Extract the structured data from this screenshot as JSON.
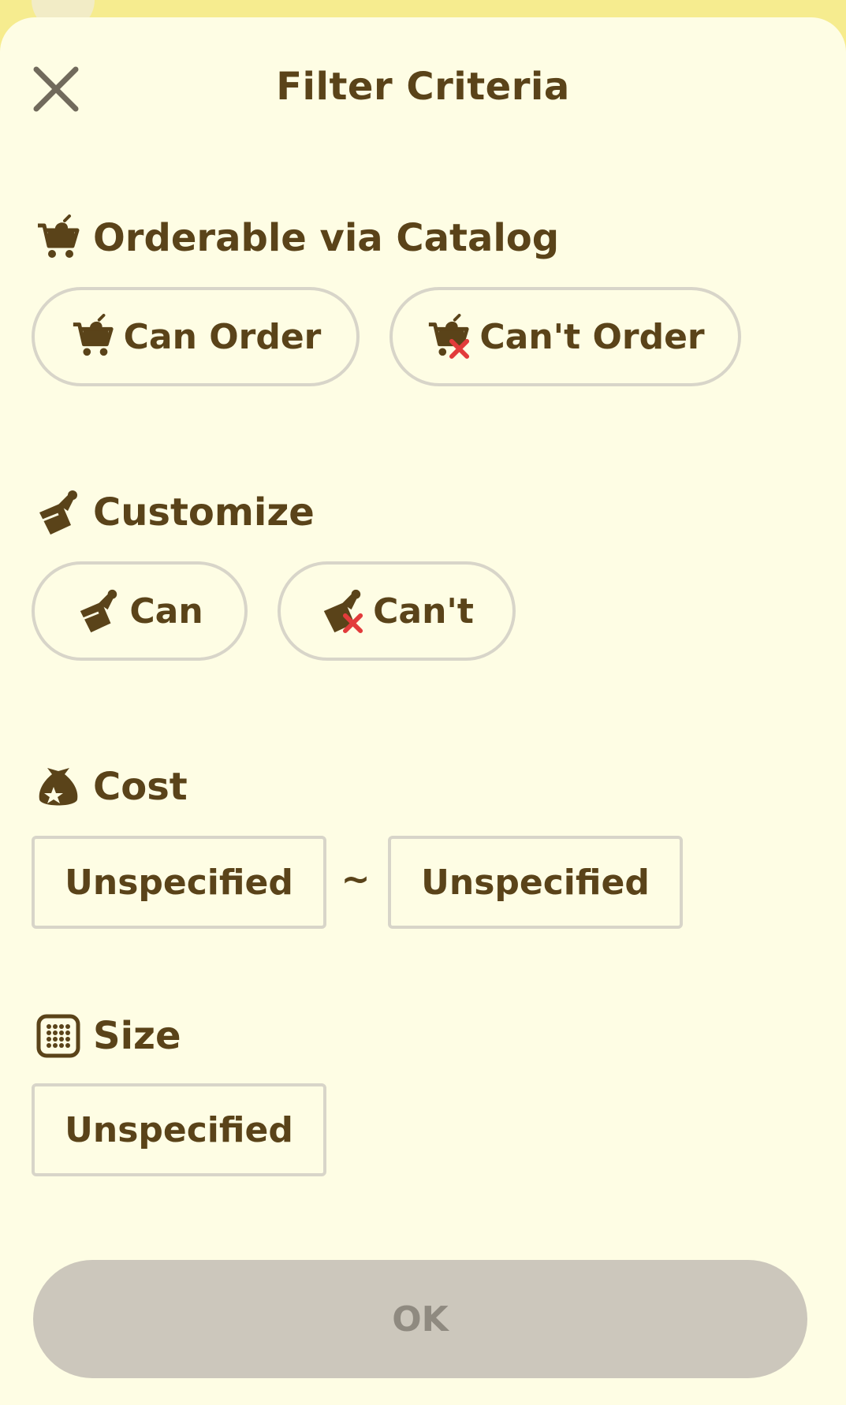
{
  "header": {
    "title": "Filter Criteria",
    "close_icon": "close-icon"
  },
  "catalog": {
    "title": "Orderable via Catalog",
    "icon": "shopping-cart-icon",
    "options": [
      {
        "label": "Can Order",
        "icon": "shopping-cart-icon"
      },
      {
        "label": "Can't Order",
        "icon": "shopping-cart-x-icon"
      }
    ]
  },
  "customize": {
    "title": "Customize",
    "icon": "brush-icon",
    "options": [
      {
        "label": "Can",
        "icon": "brush-icon"
      },
      {
        "label": "Can't",
        "icon": "brush-x-icon"
      }
    ]
  },
  "cost": {
    "title": "Cost",
    "icon": "money-bag-icon",
    "min_value": "Unspecified",
    "separator": "~",
    "max_value": "Unspecified"
  },
  "size": {
    "title": "Size",
    "icon": "grid-size-icon",
    "value": "Unspecified"
  },
  "footer": {
    "ok_label": "OK"
  },
  "colors": {
    "background": "#fefde4",
    "top_strip": "#f6ec8f",
    "text": "#5a4319",
    "border": "#d8d5c9",
    "ok_disabled_bg": "#ccc7bc",
    "ok_disabled_text": "#8f8a80",
    "cross_red": "#e23b3b"
  }
}
